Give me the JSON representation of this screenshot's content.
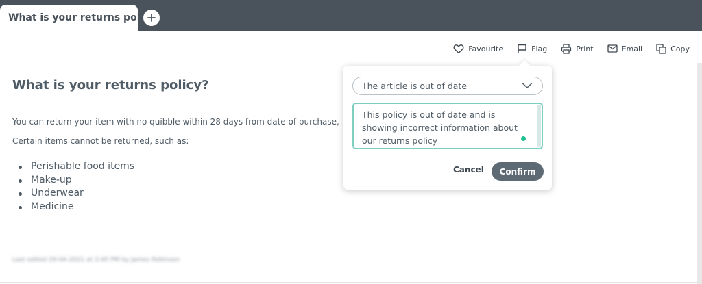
{
  "tabs": {
    "active_title": "What is your returns poli..."
  },
  "toolbar": {
    "favourite": "Favourite",
    "flag": "Flag",
    "print": "Print",
    "email": "Email",
    "copy": "Copy"
  },
  "article": {
    "title": "What is your returns policy?",
    "paragraph1": "You can return your item with no quibble within 28 days from date of purchase,",
    "paragraph2": "Certain items cannot be returned, such as:",
    "items": [
      "Perishable food items",
      "Make-up",
      "Underwear",
      "Medicine"
    ],
    "meta": "Last edited 29-04-2021 at 2:45 PM by James Robinson"
  },
  "flag_popover": {
    "reason_selected": "The article is out of date",
    "comment_value": "This policy is out of date and is showing incorrect information about our returns policy",
    "cancel_label": "Cancel",
    "confirm_label": "Confirm"
  },
  "colors": {
    "tab_bar": "#4a535b",
    "confirm_button": "#5d6a74",
    "textarea_focus": "#7fcfc0",
    "status_dot": "#1fbf8f"
  }
}
